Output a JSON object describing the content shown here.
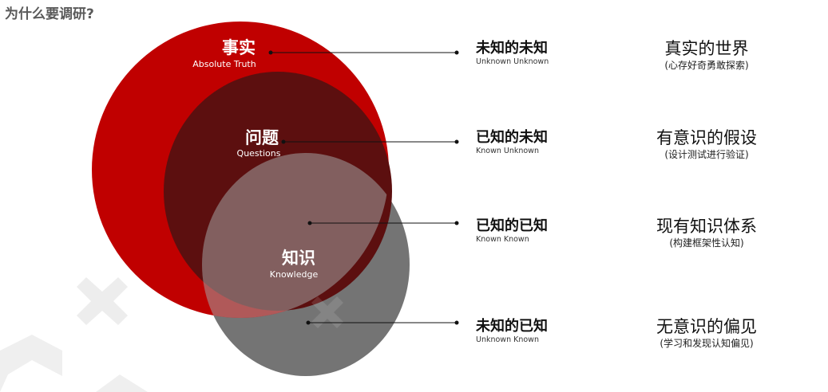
{
  "header": {
    "title": "为什么要调研?"
  },
  "colors": {
    "fact": "#c00000",
    "question": "#5c0f0f",
    "knowledge": "#7a7a7a",
    "watermark": "#ededed"
  },
  "circles": {
    "fact": {
      "label_zh": "事实",
      "label_en": "Absolute Truth"
    },
    "question": {
      "label_zh": "问题",
      "label_en": "Questions"
    },
    "knowledge": {
      "label_zh": "知识",
      "label_en": "Knowledge"
    }
  },
  "quadrants": [
    {
      "label_zh": "未知的未知",
      "label_en": "Unknown Unknown",
      "meaning": "真实的世界",
      "meaning_sub": "(心存好奇勇敢探索)"
    },
    {
      "label_zh": "已知的未知",
      "label_en": "Known Unknown",
      "meaning": "有意识的假设",
      "meaning_sub": "(设计测试进行验证)"
    },
    {
      "label_zh": "已知的已知",
      "label_en": "Known Known",
      "meaning": "现有知识体系",
      "meaning_sub": "(构建框架性认知)"
    },
    {
      "label_zh": "未知的已知",
      "label_en": "Unknown Known",
      "meaning": "无意识的偏见",
      "meaning_sub": "(学习和发现认知偏见)"
    }
  ]
}
